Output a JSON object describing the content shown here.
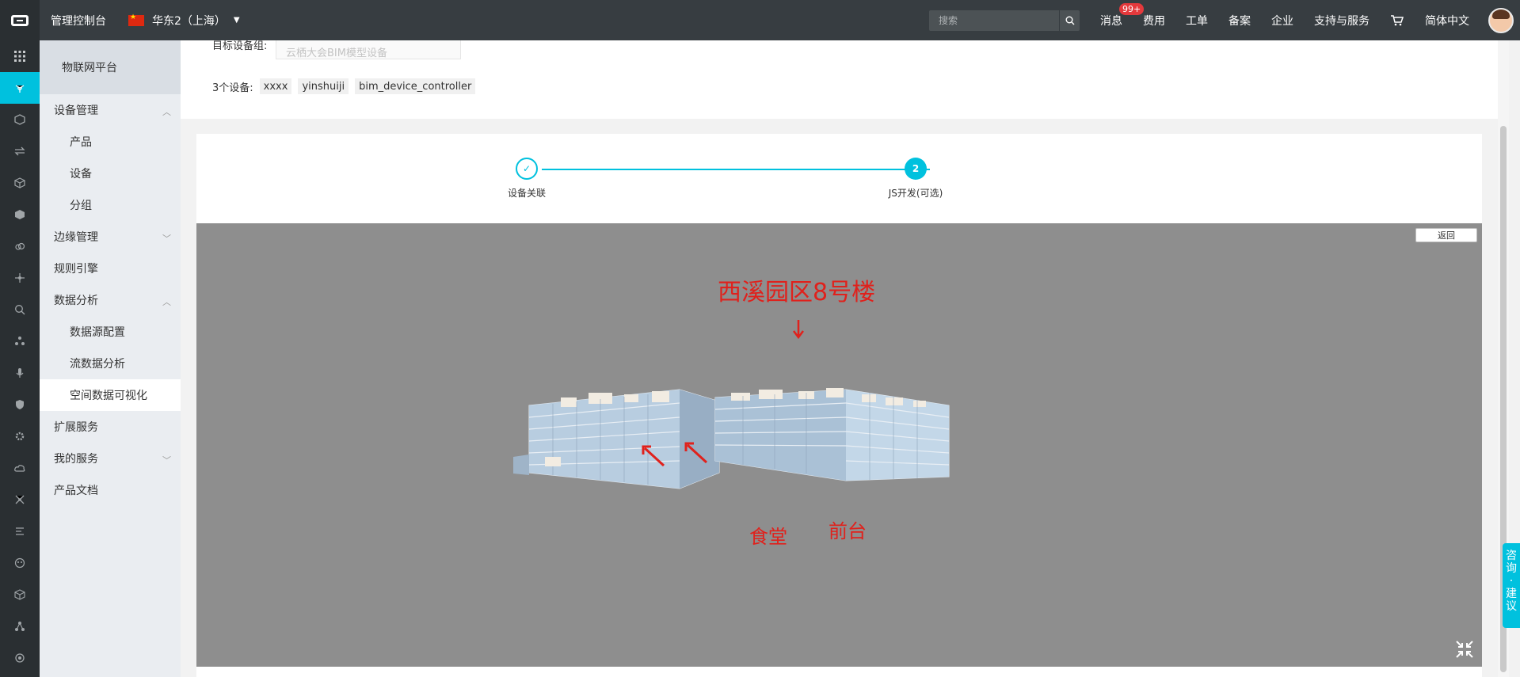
{
  "topbar": {
    "console_title": "管理控制台",
    "region": "华东2（上海）",
    "search_placeholder": "搜索",
    "nav": {
      "messages": "消息",
      "messages_badge": "99+",
      "billing": "费用",
      "tickets": "工单",
      "icp": "备案",
      "enterprise": "企业",
      "support": "支持与服务",
      "language": "简体中文"
    }
  },
  "rail": {
    "icons": [
      "grid-icon",
      "iot-icon",
      "cube-icon",
      "transfer-icon",
      "box-icon",
      "chip-icon",
      "cloud-icon",
      "network-icon",
      "search-icon",
      "cluster-icon",
      "mic-icon",
      "shield-icon",
      "gear-icon",
      "cloud-storage-icon",
      "nodes-icon",
      "flow-icon",
      "robot-icon",
      "package-icon",
      "hierarchy-icon",
      "settings-icon"
    ]
  },
  "sidebar": {
    "header": "物联网平台",
    "device_mgmt": "设备管理",
    "product": "产品",
    "device": "设备",
    "group": "分组",
    "edge_mgmt": "边缘管理",
    "rules_engine": "规则引擎",
    "data_analysis": "数据分析",
    "data_source": "数据源配置",
    "stream_analysis": "流数据分析",
    "spatial_viz": "空间数据可视化",
    "extensions": "扩展服务",
    "my_services": "我的服务",
    "product_docs": "产品文档"
  },
  "main": {
    "target_group_label": "目标设备组:",
    "target_group_value": "云栖大会BIM模型设备",
    "devices_label": "3个设备:",
    "devices": [
      "xxxx",
      "yinshuiji",
      "bim_device_controller"
    ],
    "steps": [
      {
        "label": "设备关联",
        "status": "done",
        "mark": "✓"
      },
      {
        "label": "JS开发(可选)",
        "status": "current",
        "mark": "2"
      }
    ],
    "viewer": {
      "return_label": "返回",
      "annotation_title": "西溪园区8号楼",
      "annotation_canteen": "食堂",
      "annotation_front_desk": "前台"
    }
  },
  "feedback": "咨询·建议",
  "colors": {
    "topbar_bg": "#373d41",
    "accent": "#00c1de",
    "annotation_red": "#e0211c",
    "viewer_bg": "#8e8e8e"
  }
}
